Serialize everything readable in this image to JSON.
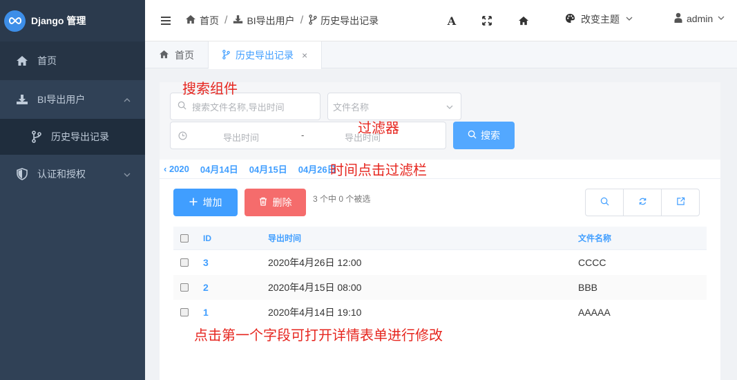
{
  "app": {
    "title": "Django 管理"
  },
  "sidebar": {
    "items": [
      {
        "label": "首页",
        "icon": "home-icon"
      },
      {
        "label": "BI导出用户",
        "icon": "download-icon",
        "expanded": true,
        "children": [
          {
            "label": "历史导出记录",
            "icon": "branch-icon"
          }
        ]
      },
      {
        "label": "认证和授权",
        "icon": "shield-icon",
        "expanded": false
      }
    ]
  },
  "navbar": {
    "breadcrumb": [
      "首页",
      "BI导出用户",
      "历史导出记录"
    ],
    "font_tool": "A",
    "theme_label": "改变主题",
    "user_label": "admin"
  },
  "tabs": [
    {
      "label": "首页",
      "active": false
    },
    {
      "label": "历史导出记录",
      "active": true,
      "close": "×"
    }
  ],
  "search": {
    "keyword_placeholder": "搜索文件名称,导出时间",
    "file_filter_placeholder": "文件名称",
    "date_start_placeholder": "导出时间",
    "date_sep": "-",
    "date_end_placeholder": "导出时间",
    "search_label": "搜索"
  },
  "date_nav": {
    "back": "‹ 2020",
    "dates": [
      "04月14日",
      "04月15日",
      "04月26日"
    ]
  },
  "actions": {
    "add_label": "增加",
    "delete_label": "删除",
    "selection_text": "3 个中 0 个被选"
  },
  "table": {
    "columns": [
      "ID",
      "导出时间",
      "文件名称"
    ],
    "rows": [
      {
        "id": "3",
        "time": "2020年4月26日 12:00",
        "file": "CCCC"
      },
      {
        "id": "2",
        "time": "2020年4月15日 08:00",
        "file": "BBB"
      },
      {
        "id": "1",
        "time": "2020年4月14日 19:10",
        "file": "AAAAA"
      }
    ]
  },
  "annotations": {
    "search": "搜索组件",
    "filter": "过滤器",
    "date_filter": "时间点击过滤栏",
    "edit_hint": "点击第一个字段可打开详情表单进行修改"
  },
  "colors": {
    "sidebar_bg": "#304156",
    "primary": "#409eff",
    "danger": "#f56c6c",
    "annotation": "#e6261f"
  }
}
